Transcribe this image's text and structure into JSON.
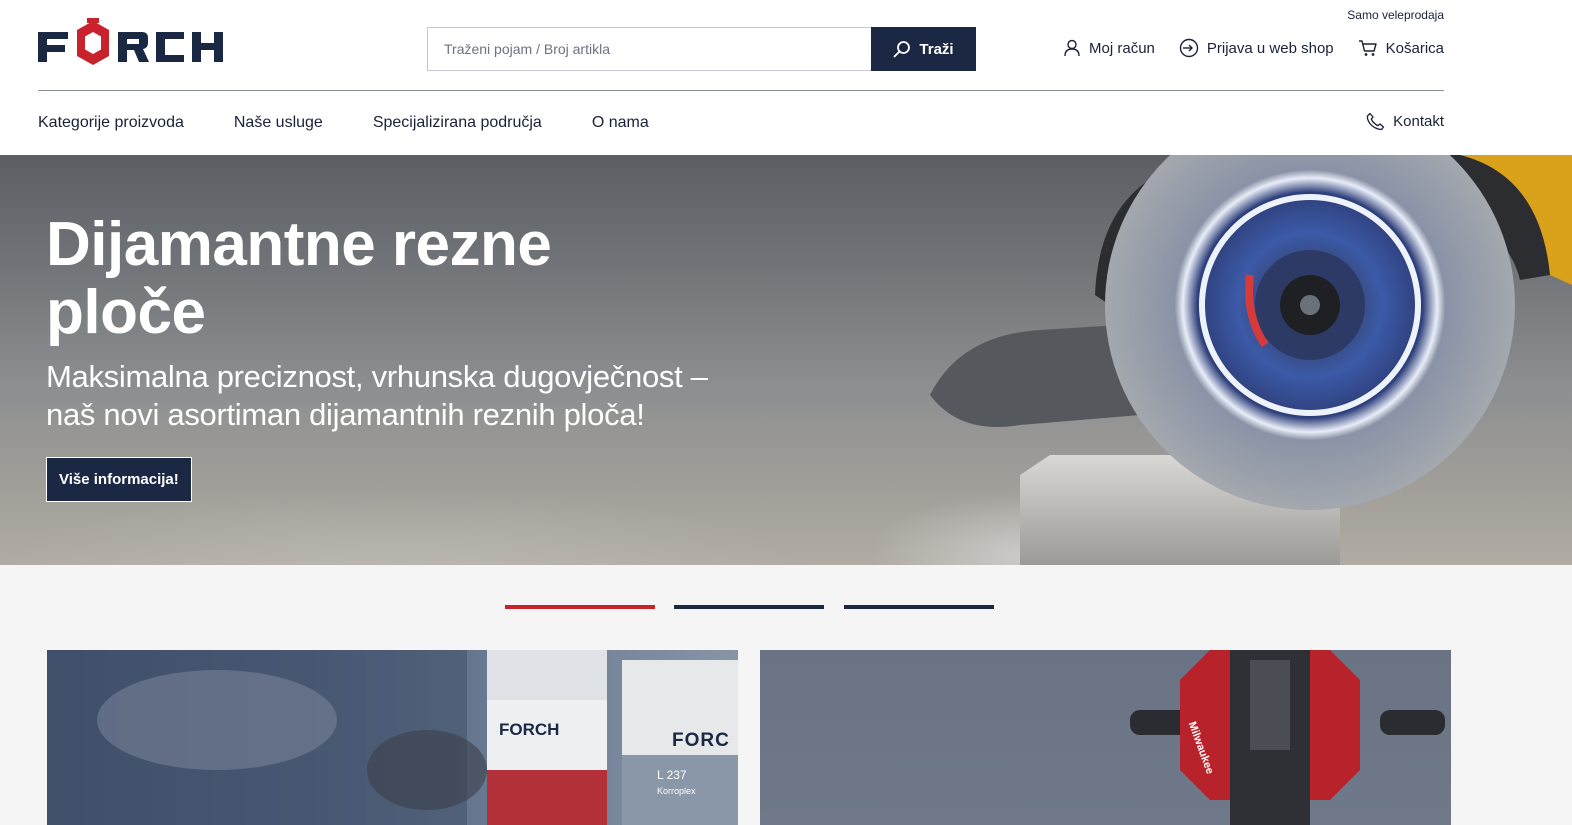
{
  "header": {
    "wholesale_note": "Samo veleprodaja",
    "logo_text": "FORCH",
    "search": {
      "placeholder": "Traženi pojam / Broj artikla",
      "button_label": "Traži"
    },
    "user_links": [
      {
        "label": "Moj račun",
        "icon": "user-icon"
      },
      {
        "label": "Prijava u web shop",
        "icon": "login-icon"
      },
      {
        "label": "Košarica",
        "icon": "cart-icon"
      }
    ]
  },
  "nav": {
    "items": [
      "Kategorije proizvoda",
      "Naše usluge",
      "Specijalizirana područja",
      "O nama"
    ],
    "contact_label": "Kontakt",
    "contact_icon": "phone-icon"
  },
  "hero": {
    "title_line1": "Dijamantne rezne",
    "title_line2": "ploče",
    "subtitle_line1": "Maksimalna preciznost, vrhunska dugovječnost –",
    "subtitle_line2": "naš novi asortiman dijamantnih reznih ploča!",
    "button_label": "Više informacija!"
  },
  "slider": {
    "slide_count": 3,
    "active_index": 0
  },
  "cards": [
    {
      "logo_1": "FORCH",
      "logo_2": "FORC",
      "product_label": "L 237",
      "product_name": "Korroplex"
    },
    {
      "brand": "Milwaukee"
    }
  ],
  "colors": {
    "brand_navy": "#1b2843",
    "brand_red": "#c8222c",
    "text": "#1a2238"
  }
}
